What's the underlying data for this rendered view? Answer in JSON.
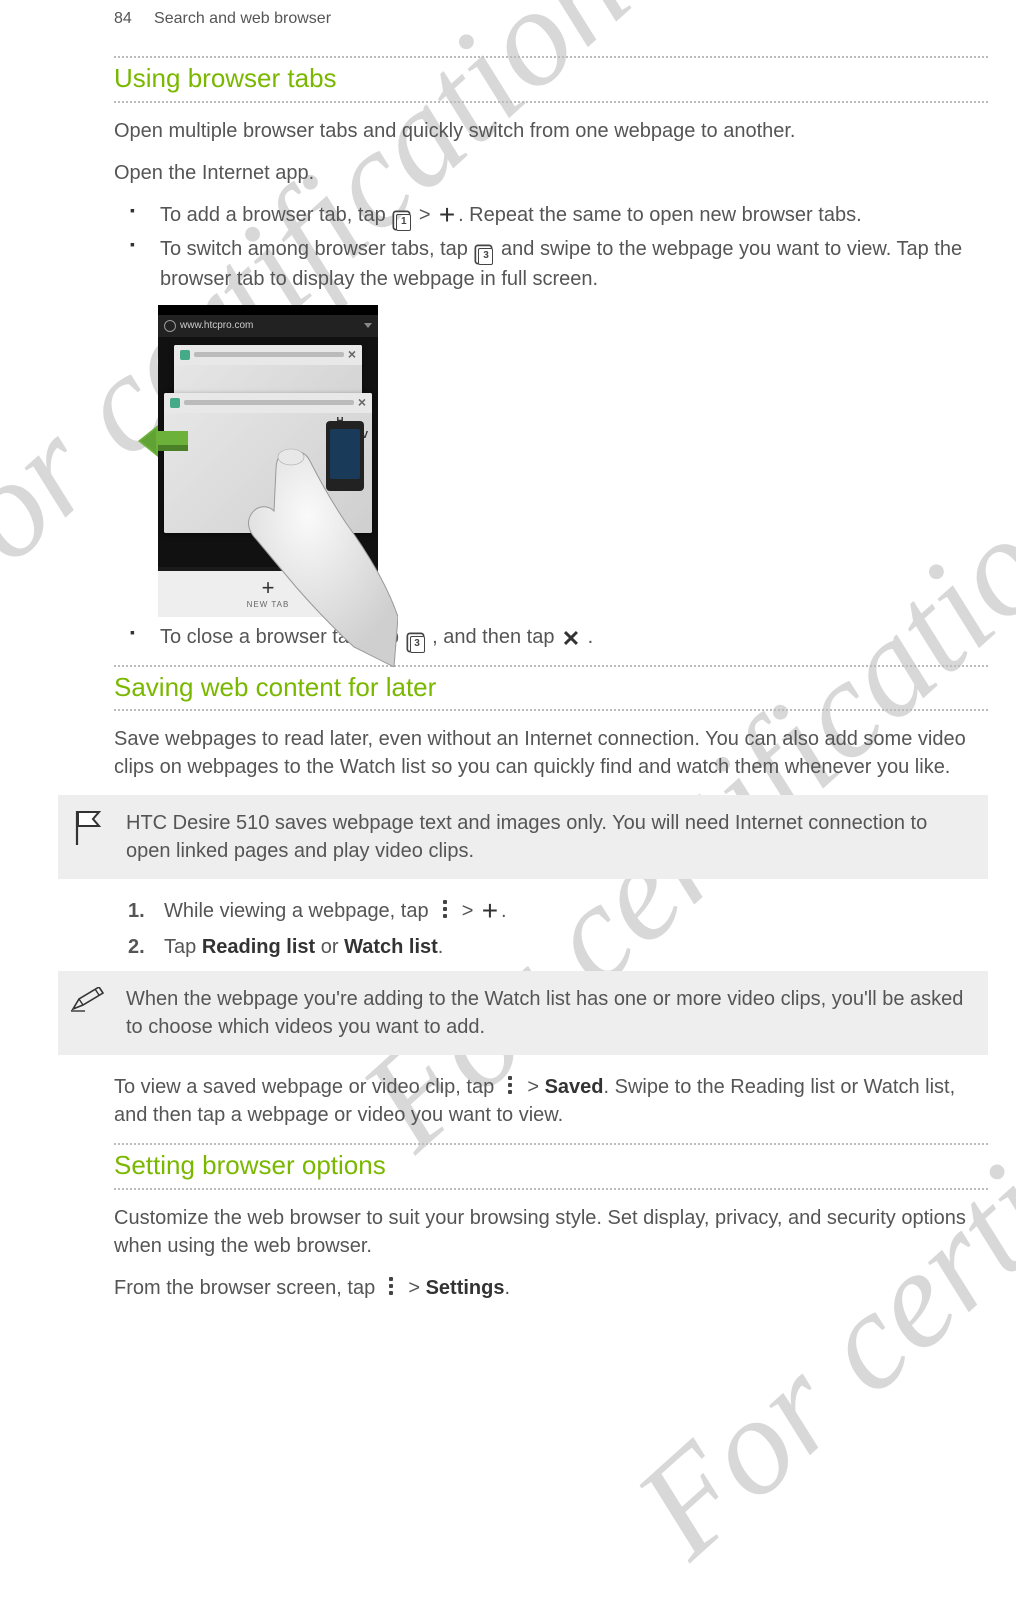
{
  "watermark": "For certification only",
  "watermark_partial": "For certification",
  "header": {
    "page": "84",
    "section": "Search and web browser"
  },
  "sections": {
    "tabs": {
      "heading": "Using browser tabs",
      "intro": "Open multiple browser tabs and quickly switch from one webpage to another.",
      "open_app": "Open the Internet app.",
      "bullets": {
        "add": {
          "pre": "To add a browser tab, tap ",
          "gt": " > ",
          "post": ". Repeat the same to open new browser tabs."
        },
        "switch": {
          "pre": "To switch among browser tabs, tap ",
          "post": " and swipe to the webpage you want to view. Tap the browser tab to display the webpage in full screen."
        },
        "close": {
          "pre": "To close a browser tab, tap ",
          "mid": " , and then tap ",
          "post": " ."
        }
      },
      "screenshot": {
        "url": "www.htcpro.com",
        "new_tab": "NEW TAB"
      }
    },
    "saving": {
      "heading": "Saving web content for later",
      "intro": "Save webpages to read later, even without an Internet connection. You can also add some video clips on webpages to the Watch list so you can quickly find and watch them whenever you like.",
      "flag_note": "HTC Desire 510 saves webpage text and images only. You will need Internet connection to open linked pages and play video clips.",
      "steps": [
        {
          "pre": "While viewing a webpage, tap ",
          "gt": " > ",
          "post": "."
        },
        {
          "pre": "Tap ",
          "b1": "Reading list",
          "or": " or ",
          "b2": "Watch list",
          "post": "."
        }
      ],
      "pencil_note": "When the webpage you're adding to the Watch list has one or more video clips, you'll be asked to choose which videos you want to add.",
      "view": {
        "pre": "To view a saved webpage or video clip, tap ",
        "gt": " > ",
        "saved": "Saved",
        "post": ". Swipe to the Reading list or Watch list, and then tap a webpage or video you want to view."
      }
    },
    "options": {
      "heading": "Setting browser options",
      "intro": "Customize the web browser to suit your browsing style. Set display, privacy, and security options when using the web browser.",
      "from": {
        "pre": "From the browser screen, tap ",
        "gt": " > ",
        "settings": "Settings",
        "post": "."
      }
    }
  }
}
